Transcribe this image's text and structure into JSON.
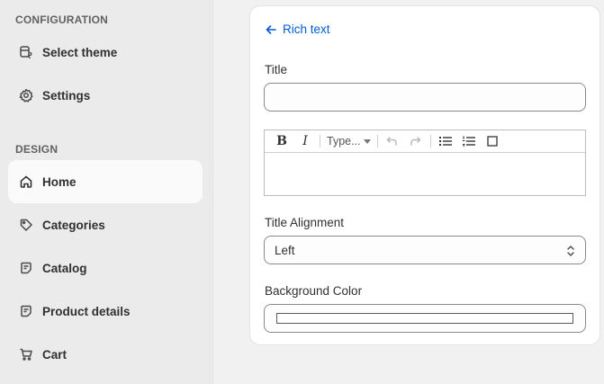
{
  "sidebar": {
    "configuration_label": "CONFIGURATION",
    "design_label": "DESIGN",
    "config_items": [
      {
        "label": "Select theme",
        "icon": "theme-icon"
      },
      {
        "label": "Settings",
        "icon": "gear-icon"
      }
    ],
    "design_items": [
      {
        "label": "Home",
        "icon": "home-icon",
        "active": true
      },
      {
        "label": "Categories",
        "icon": "tag-icon"
      },
      {
        "label": "Catalog",
        "icon": "note-icon"
      },
      {
        "label": "Product details",
        "icon": "note-icon"
      },
      {
        "label": "Cart",
        "icon": "cart-icon"
      }
    ]
  },
  "panel": {
    "back_label": "Rich text",
    "title_label": "Title",
    "title_value": "",
    "editor": {
      "format_select": "Type...",
      "content": ""
    },
    "alignment_label": "Title Alignment",
    "alignment_value": "Left",
    "bg_color_label": "Background Color",
    "bg_color_value": "#ffffff"
  },
  "colors": {
    "accent": "#005bd3",
    "sidebar_bg": "#ebebeb",
    "page_bg": "#f1f1f1"
  }
}
